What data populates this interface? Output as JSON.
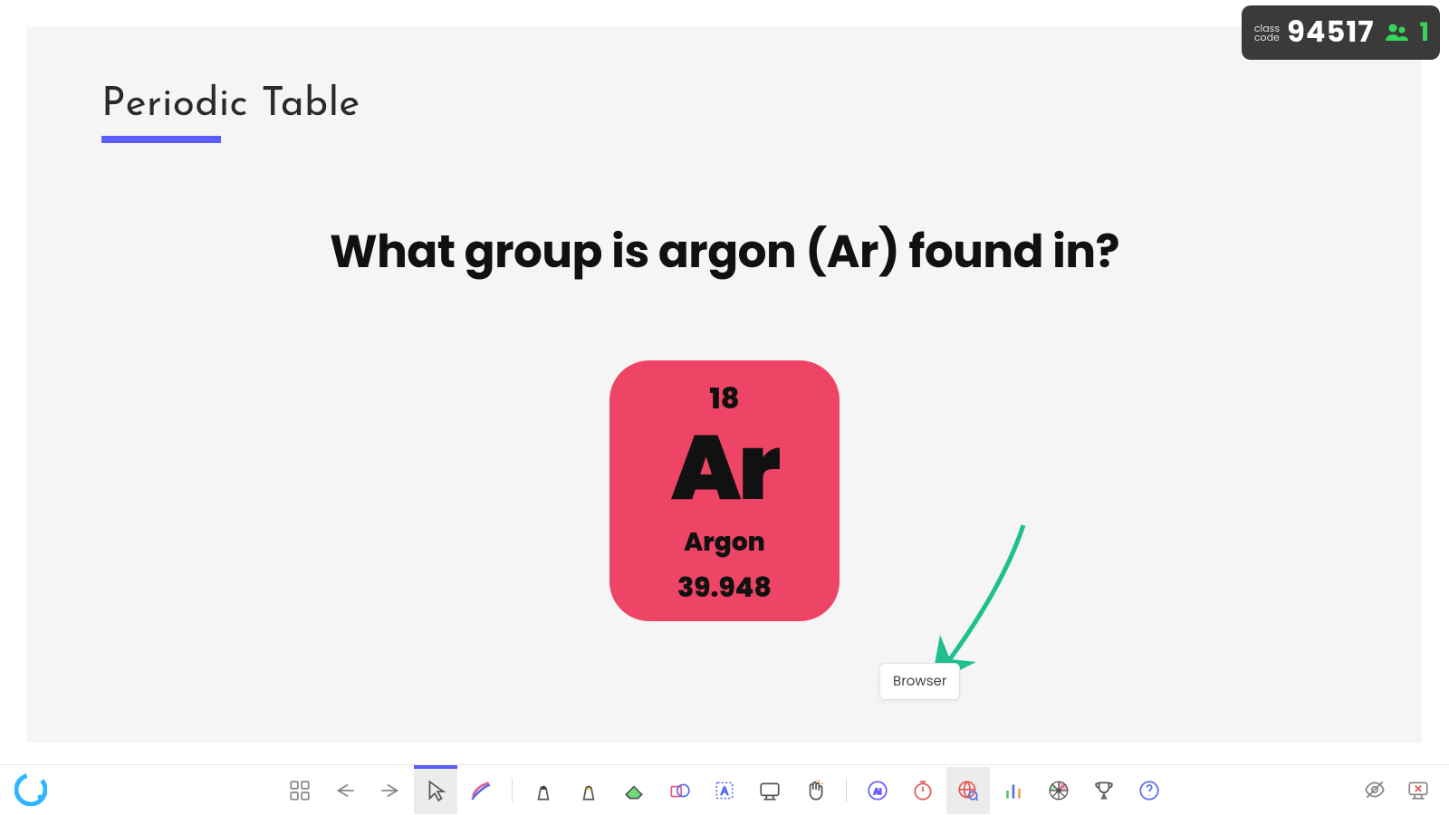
{
  "slide": {
    "title": "Periodic Table",
    "question": "What group is argon (Ar) found in?",
    "element": {
      "atomic_number": "18",
      "symbol": "Ar",
      "name": "Argon",
      "mass": "39.948"
    }
  },
  "class_badge": {
    "label_line1": "class",
    "label_line2": "code",
    "code": "94517",
    "people_count": "1"
  },
  "tooltip": {
    "browser": "Browser"
  },
  "toolbar": {
    "apps": "apps",
    "back": "back",
    "forward": "forward",
    "pointer": "pointer",
    "pen": "pen",
    "highlighter1": "highlighter-dark",
    "highlighter2": "highlighter-yellow",
    "eraser": "eraser",
    "shapes": "shapes",
    "text": "text",
    "whiteboard": "whiteboard",
    "hand": "hand",
    "ai": "AI",
    "timer": "timer",
    "browser": "browser",
    "poll": "poll",
    "spinner": "spinner",
    "trophy": "trophy",
    "help": "help",
    "hide": "hide",
    "end": "end-presentation"
  }
}
